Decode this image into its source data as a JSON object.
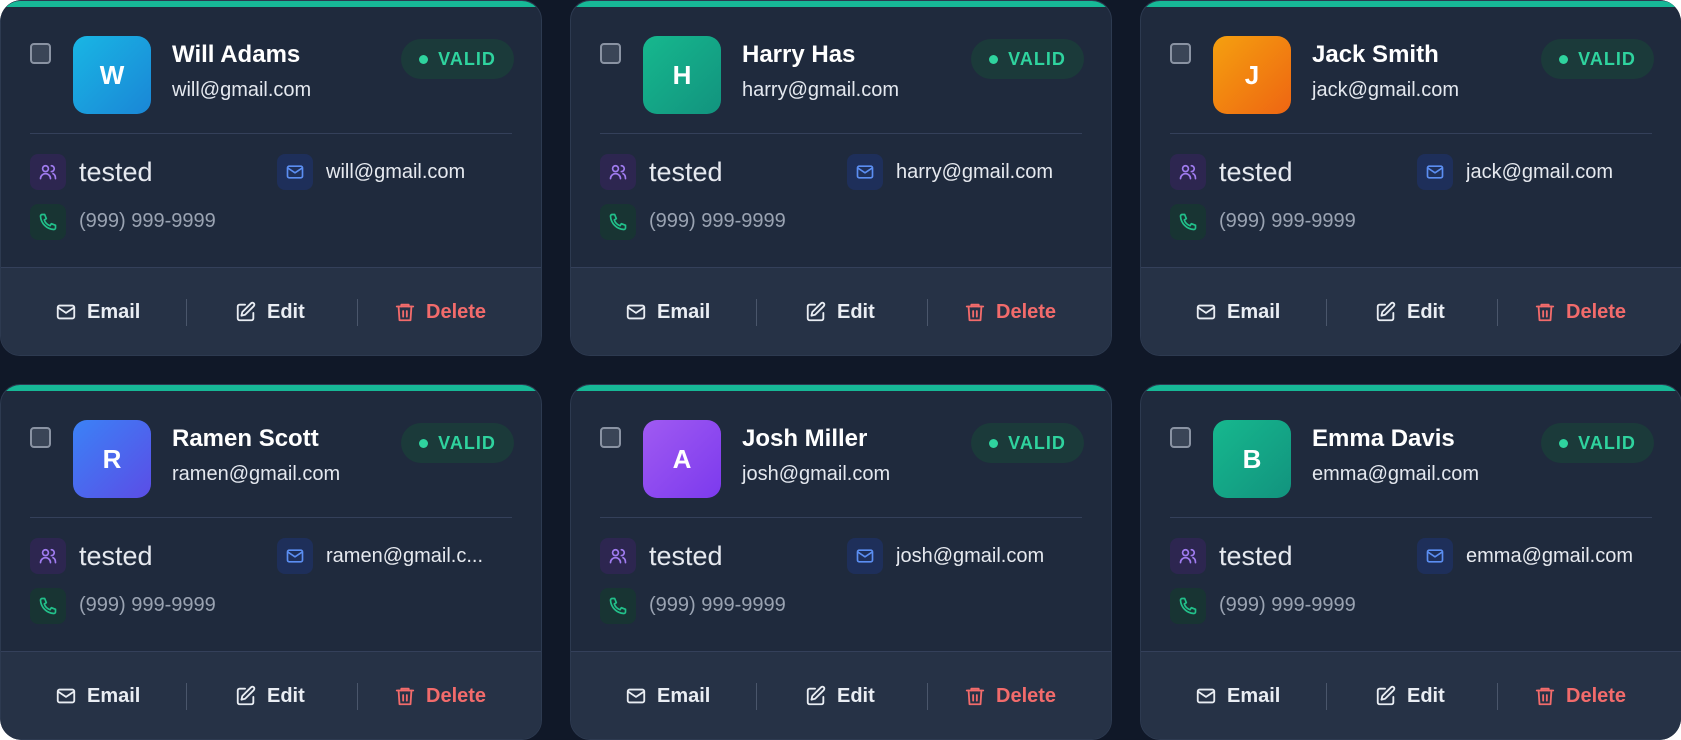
{
  "contacts": [
    {
      "initial": "W",
      "name": "Will Adams",
      "email": "will@gmail.com",
      "status": "VALID",
      "tag": "tested",
      "phone": "(999) 999-9999",
      "avatar_color": "#1a9ee0"
    },
    {
      "initial": "H",
      "name": "Harry Has",
      "email": "harry@gmail.com",
      "status": "VALID",
      "tag": "tested",
      "phone": "(999) 999-9999",
      "avatar_color": "#14a986"
    },
    {
      "initial": "J",
      "name": "Jack Smith",
      "email": "jack@gmail.com",
      "status": "VALID",
      "tag": "tested",
      "phone": "(999) 999-9999",
      "avatar_color": "#f27d12"
    },
    {
      "initial": "R",
      "name": "Ramen Scott",
      "email": "ramen@gmail.com",
      "email_display": "ramen@gmail.c...",
      "status": "VALID",
      "tag": "tested",
      "phone": "(999) 999-9999",
      "avatar_color": "#4f63ee"
    },
    {
      "initial": "A",
      "name": "Josh Miller",
      "email": "josh@gmail.com",
      "status": "VALID",
      "tag": "tested",
      "phone": "(999) 999-9999",
      "avatar_color": "#9146ec"
    },
    {
      "initial": "B",
      "name": "Emma Davis",
      "email": "emma@gmail.com",
      "status": "VALID",
      "tag": "tested",
      "phone": "(999) 999-9999",
      "avatar_color": "#14a986"
    }
  ],
  "actions": {
    "email_label": "Email",
    "edit_label": "Edit",
    "delete_label": "Delete"
  },
  "colors": {
    "accent_top_bar": "#17b897",
    "valid": "#2fd39e",
    "delete": "#f26b6b",
    "card_bg": "#1f2a3d",
    "page_bg": "#101828"
  },
  "icons": {
    "tag": "users-icon",
    "email": "mail-icon",
    "phone": "phone-icon",
    "edit": "pencil-square-icon",
    "delete": "trash-icon"
  }
}
